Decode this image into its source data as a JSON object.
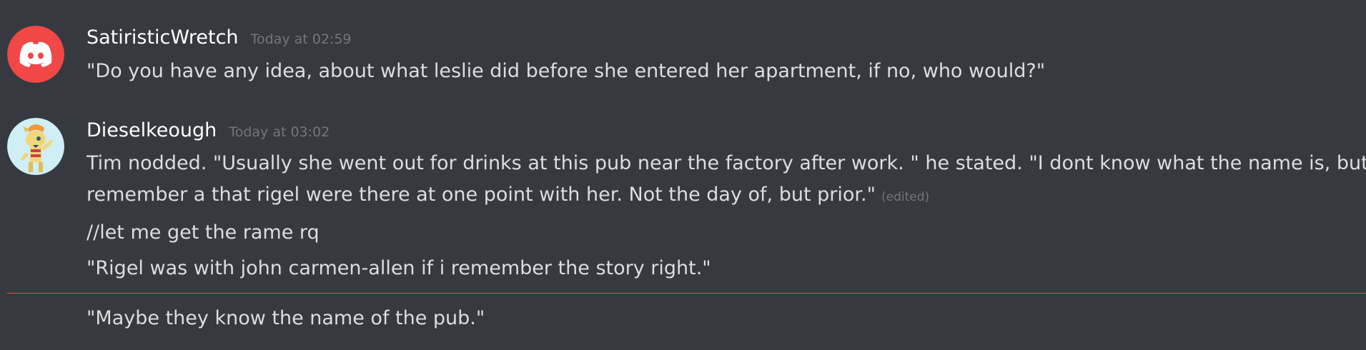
{
  "messages": [
    {
      "author": "SatiristicWretch",
      "timestamp": "Today at 02:59",
      "avatar_icon": "discord-logo-icon",
      "avatar_color": "#f04747",
      "lines": [
        "\"Do you have any idea, about what leslie did before she entered her apartment, if no, who would?\""
      ]
    },
    {
      "author": "Dieselkeough",
      "timestamp": "Today at 03:02",
      "avatar_icon": "pony-avatar-icon",
      "avatar_color": "#cfeef5",
      "lines": [
        "Tim nodded. \"Usually she went out for drinks at this pub near the factory after work. \" he stated. \"I dont know what the name is, but i",
        "remember a that rigel were there at one point with her. Not the day of, but prior.\"",
        "//let me get the rame rq",
        "\"Rigel was with john carmen-allen if i remember the story right.\"",
        "\"Maybe they know the name of the pub.\""
      ],
      "edited_label": "(edited)"
    }
  ],
  "colors": {
    "background": "#36393f",
    "username": "#ffffff",
    "text": "#dcddde",
    "muted": "#72767d",
    "new_messages_divider": "#f04747"
  }
}
